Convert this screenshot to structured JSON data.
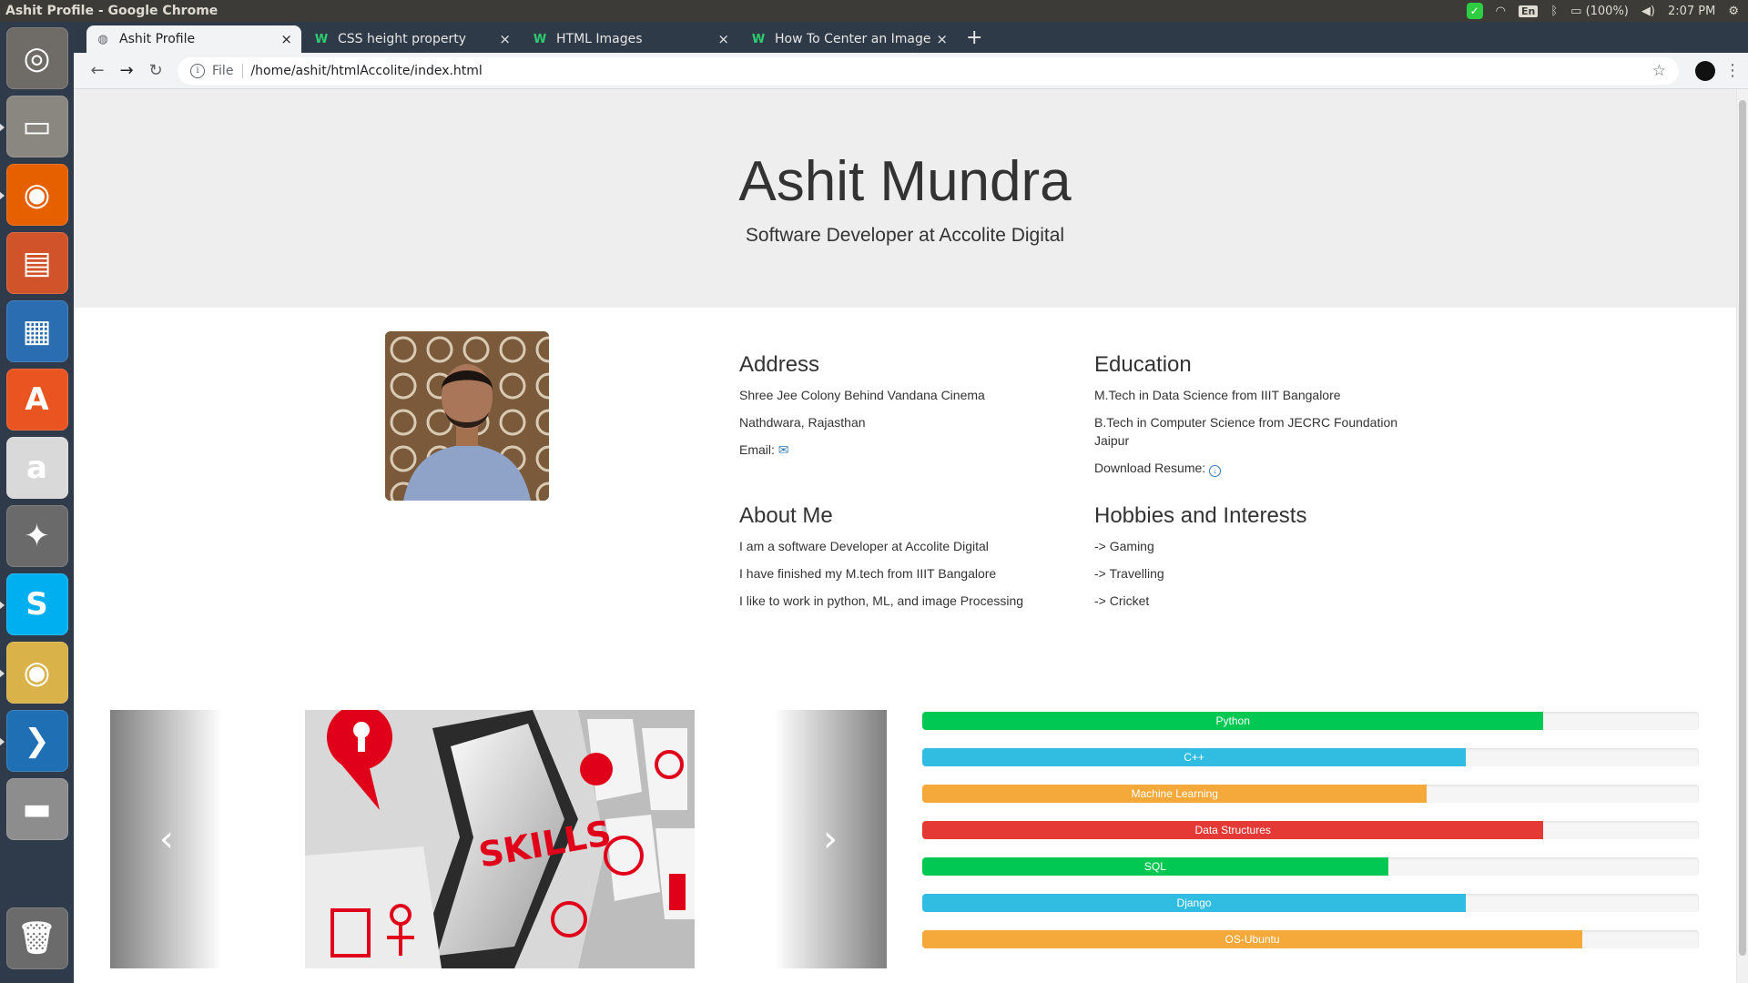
{
  "window": {
    "title": "Ashit Profile - Google Chrome"
  },
  "panel": {
    "keyboard": "En",
    "battery": "(100%)",
    "clock": "2:07 PM"
  },
  "launcher_items": [
    {
      "name": "ubuntu-dash-icon",
      "glyph": "◎",
      "color": "#6f6b66"
    },
    {
      "name": "files-icon",
      "glyph": "▭",
      "color": "#8a8680"
    },
    {
      "name": "firefox-icon",
      "glyph": "◉",
      "color": "#e66000"
    },
    {
      "name": "impress-icon",
      "glyph": "▤",
      "color": "#d0532a"
    },
    {
      "name": "writer-icon",
      "glyph": "▦",
      "color": "#2a6db0"
    },
    {
      "name": "software-center-icon",
      "glyph": "A",
      "color": "#e95420"
    },
    {
      "name": "amazon-icon",
      "glyph": "a",
      "color": "#d9d9d9"
    },
    {
      "name": "system-settings-icon",
      "glyph": "✦",
      "color": "#6a6a6a"
    },
    {
      "name": "skype-icon",
      "glyph": "S",
      "color": "#00aff0"
    },
    {
      "name": "chrome-icon",
      "glyph": "◉",
      "color": "#d9b24a"
    },
    {
      "name": "vscode-icon",
      "glyph": "❯",
      "color": "#1f6fb5"
    },
    {
      "name": "disk-icon",
      "glyph": "▬",
      "color": "#8d8d8d"
    }
  ],
  "tabs": [
    {
      "label": "Ashit Profile",
      "icon": "◍",
      "active": true
    },
    {
      "label": "CSS height property",
      "icon": "W",
      "active": false
    },
    {
      "label": "HTML Images",
      "icon": "W",
      "active": false
    },
    {
      "label": "How To Center an Image",
      "icon": "W",
      "active": false
    }
  ],
  "omnibox": {
    "scheme": "File",
    "url": "/home/ashit/htmlAccolite/index.html"
  },
  "header": {
    "name": "Ashit Mundra",
    "subtitle": "Software Developer at Accolite Digital"
  },
  "address": {
    "heading": "Address",
    "line1": "Shree Jee Colony Behind Vandana Cinema",
    "line2": "Nathdwara, Rajasthan",
    "email_label": "Email: "
  },
  "education": {
    "heading": "Education",
    "line1": "M.Tech in Data Science from IIIT Bangalore",
    "line2": "B.Tech in Computer Science from JECRC Foundation Jaipur",
    "resume_label": "Download Resume: "
  },
  "about": {
    "heading": "About Me",
    "items": [
      "I am a software Developer at Accolite Digital",
      "I have finished my M.tech from IIIT Bangalore",
      "I like to work in python, ML, and image Processing"
    ]
  },
  "hobbies": {
    "heading": "Hobbies and Interests",
    "items": [
      "-> Gaming",
      "-> Travelling",
      "-> Cricket"
    ]
  },
  "carousel": {
    "slide_text": "SKILLS",
    "prev": "‹",
    "next": "›"
  },
  "skills": [
    {
      "label": "Python",
      "percent": 80,
      "color": "#00c853"
    },
    {
      "label": "C++",
      "percent": 70,
      "color": "#31bde1"
    },
    {
      "label": "Machine Learning",
      "percent": 65,
      "color": "#f5a93b"
    },
    {
      "label": "Data Structures",
      "percent": 80,
      "color": "#e53935"
    },
    {
      "label": "SQL",
      "percent": 60,
      "color": "#00c853"
    },
    {
      "label": "Django",
      "percent": 70,
      "color": "#31bde1"
    },
    {
      "label": "OS-Ubuntu",
      "percent": 85,
      "color": "#f5a93b"
    }
  ]
}
